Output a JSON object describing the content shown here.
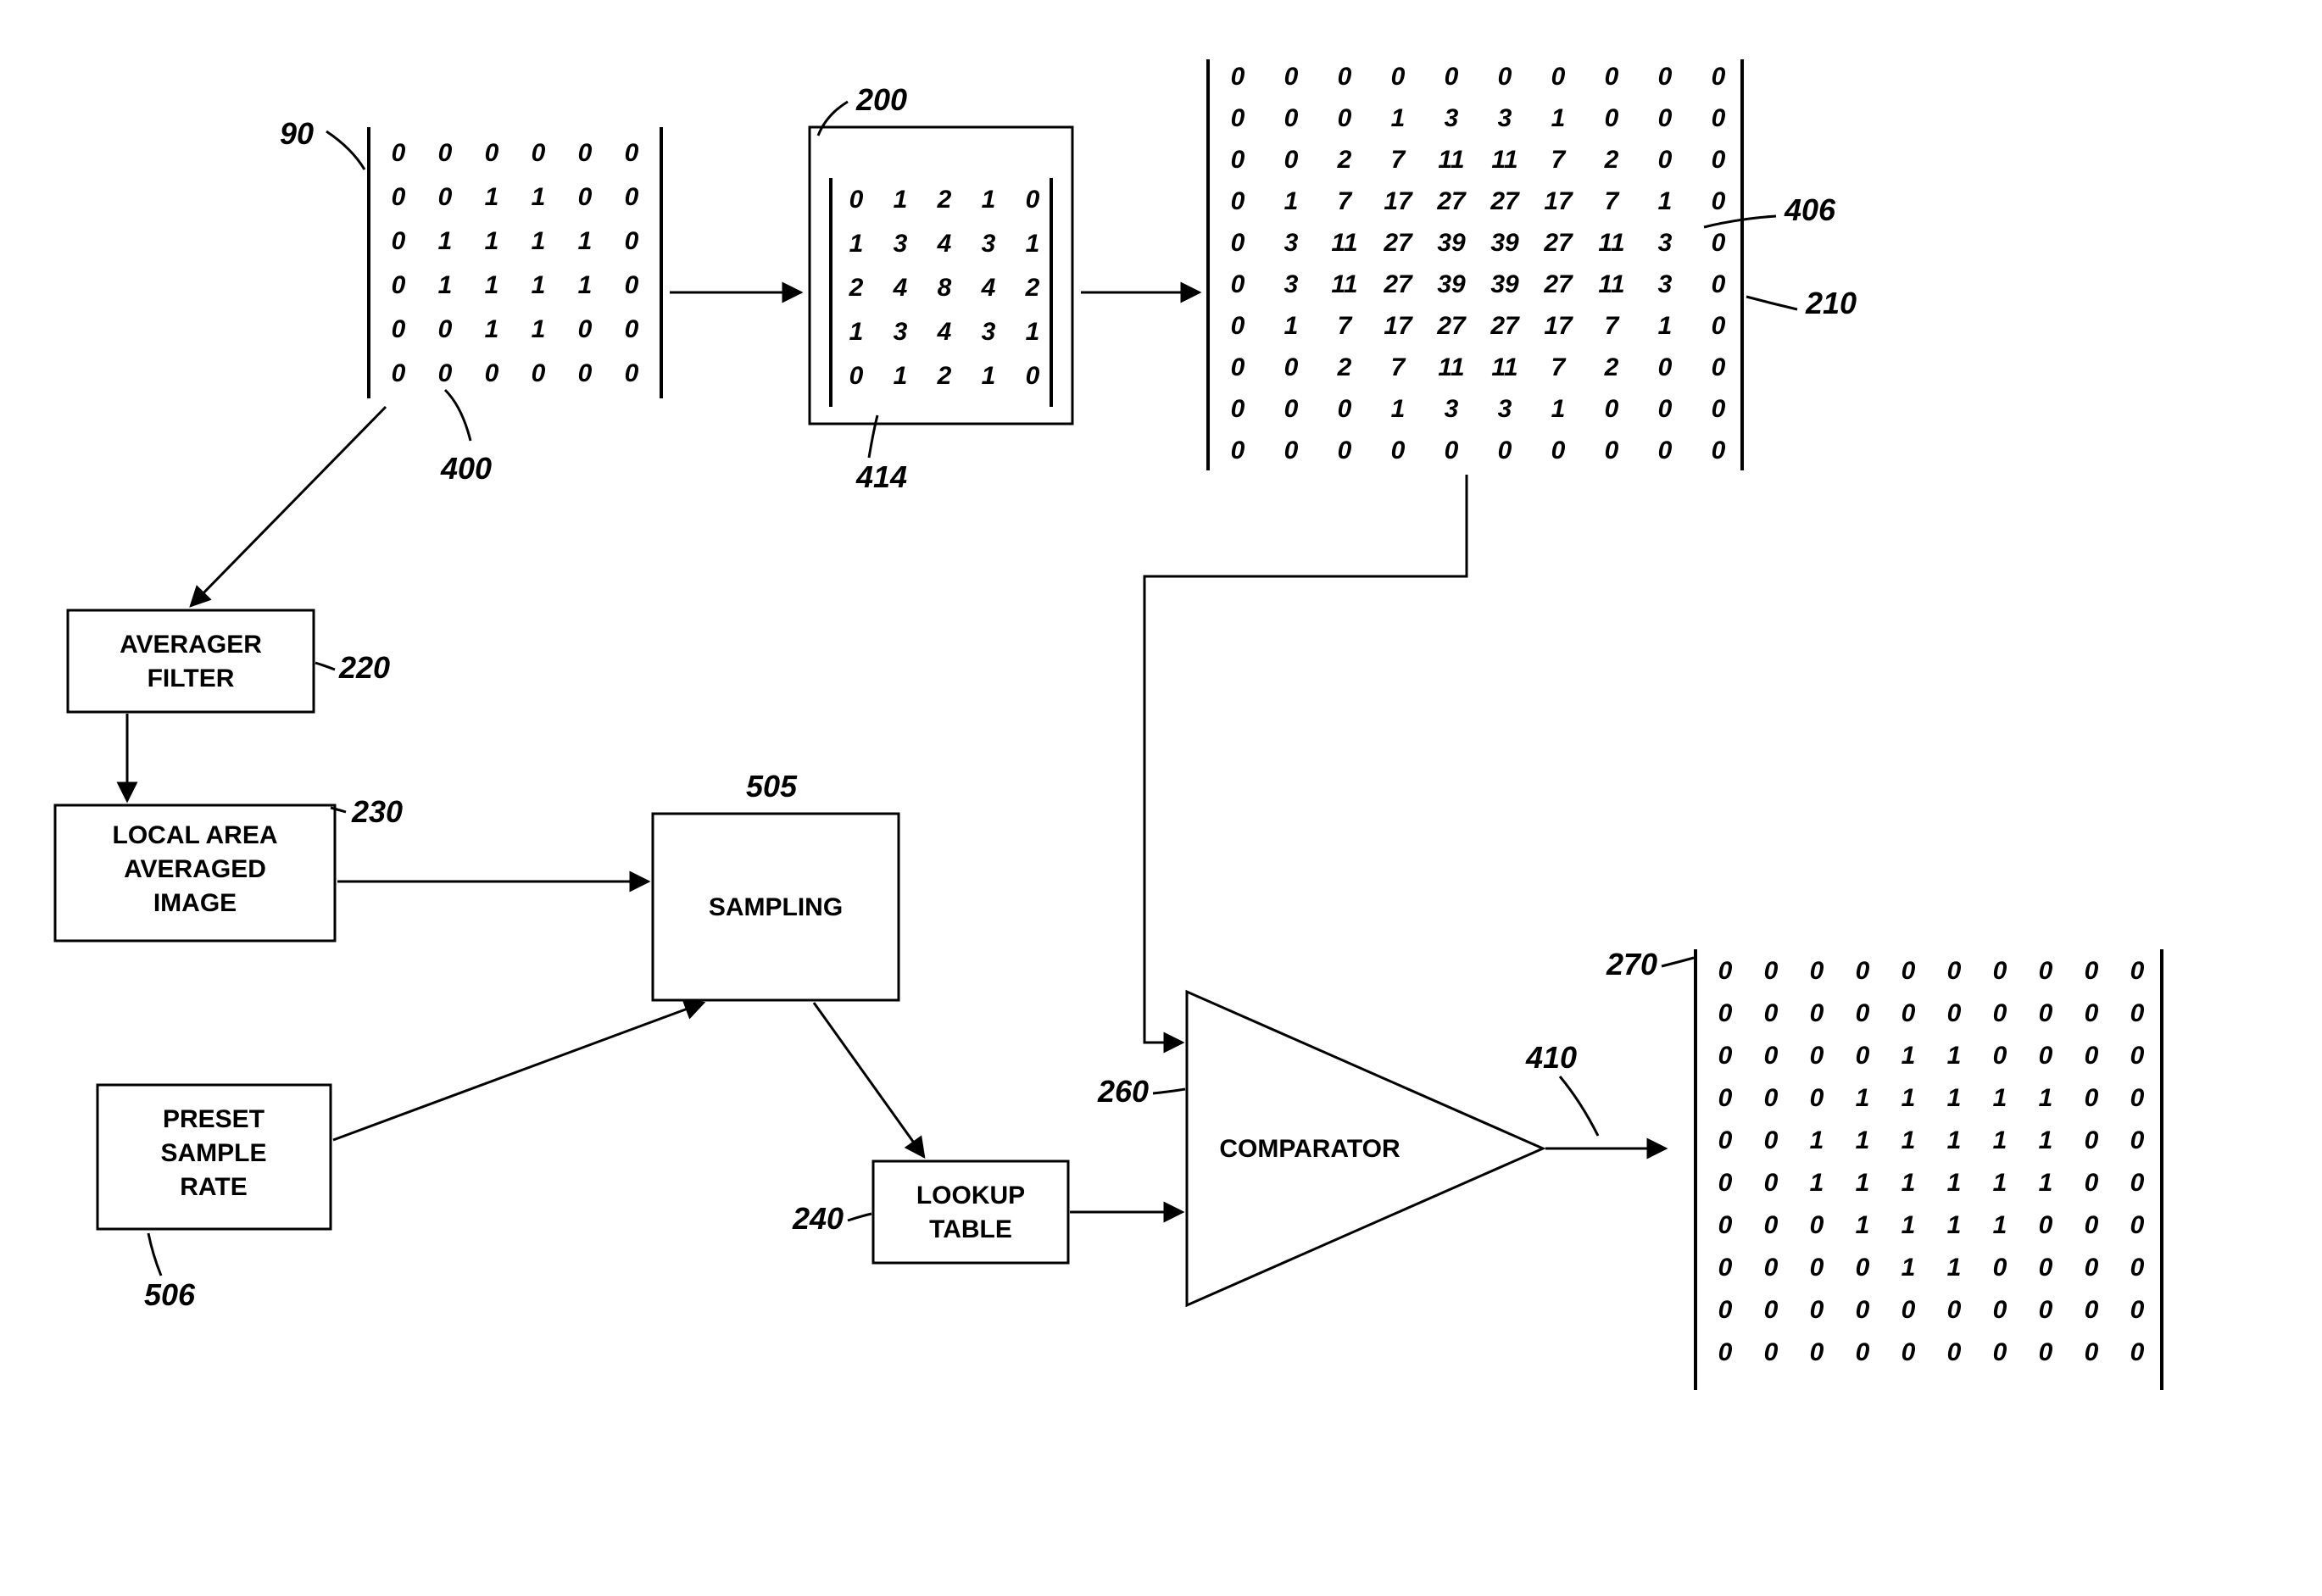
{
  "labels": {
    "l90": "90",
    "l200": "200",
    "l210": "210",
    "l400": "400",
    "l406": "406",
    "l414": "414",
    "l220": "220",
    "l230": "230",
    "l505": "505",
    "l506": "506",
    "l240": "240",
    "l260": "260",
    "l270": "270",
    "l410": "410"
  },
  "blocks": {
    "averager_l1": "AVERAGER",
    "averager_l2": "FILTER",
    "laa_l1": "LOCAL AREA",
    "laa_l2": "AVERAGED",
    "laa_l3": "IMAGE",
    "sampling": "SAMPLING",
    "preset_l1": "PRESET",
    "preset_l2": "SAMPLE",
    "preset_l3": "RATE",
    "lookup_l1": "LOOKUP",
    "lookup_l2": "TABLE",
    "comparator": "COMPARATOR"
  },
  "matrices": {
    "m90": [
      [
        "0",
        "0",
        "0",
        "0",
        "0",
        "0"
      ],
      [
        "0",
        "0",
        "1",
        "1",
        "0",
        "0"
      ],
      [
        "0",
        "1",
        "1",
        "1",
        "1",
        "0"
      ],
      [
        "0",
        "1",
        "1",
        "1",
        "1",
        "0"
      ],
      [
        "0",
        "0",
        "1",
        "1",
        "0",
        "0"
      ],
      [
        "0",
        "0",
        "0",
        "0",
        "0",
        "0"
      ]
    ],
    "m200": [
      [
        "0",
        "1",
        "2",
        "1",
        "0"
      ],
      [
        "1",
        "3",
        "4",
        "3",
        "1"
      ],
      [
        "2",
        "4",
        "8",
        "4",
        "2"
      ],
      [
        "1",
        "3",
        "4",
        "3",
        "1"
      ],
      [
        "0",
        "1",
        "2",
        "1",
        "0"
      ]
    ],
    "m210": [
      [
        "0",
        "0",
        "0",
        "0",
        "0",
        "0",
        "0",
        "0",
        "0",
        "0"
      ],
      [
        "0",
        "0",
        "0",
        "1",
        "3",
        "3",
        "1",
        "0",
        "0",
        "0"
      ],
      [
        "0",
        "0",
        "2",
        "7",
        "11",
        "11",
        "7",
        "2",
        "0",
        "0"
      ],
      [
        "0",
        "1",
        "7",
        "17",
        "27",
        "27",
        "17",
        "7",
        "1",
        "0"
      ],
      [
        "0",
        "3",
        "11",
        "27",
        "39",
        "39",
        "27",
        "11",
        "3",
        "0"
      ],
      [
        "0",
        "3",
        "11",
        "27",
        "39",
        "39",
        "27",
        "11",
        "3",
        "0"
      ],
      [
        "0",
        "1",
        "7",
        "17",
        "27",
        "27",
        "17",
        "7",
        "1",
        "0"
      ],
      [
        "0",
        "0",
        "2",
        "7",
        "11",
        "11",
        "7",
        "2",
        "0",
        "0"
      ],
      [
        "0",
        "0",
        "0",
        "1",
        "3",
        "3",
        "1",
        "0",
        "0",
        "0"
      ],
      [
        "0",
        "0",
        "0",
        "0",
        "0",
        "0",
        "0",
        "0",
        "0",
        "0"
      ]
    ],
    "m270": [
      [
        "0",
        "0",
        "0",
        "0",
        "0",
        "0",
        "0",
        "0",
        "0",
        "0"
      ],
      [
        "0",
        "0",
        "0",
        "0",
        "0",
        "0",
        "0",
        "0",
        "0",
        "0"
      ],
      [
        "0",
        "0",
        "0",
        "0",
        "1",
        "1",
        "0",
        "0",
        "0",
        "0"
      ],
      [
        "0",
        "0",
        "0",
        "1",
        "1",
        "1",
        "1",
        "1",
        "0",
        "0"
      ],
      [
        "0",
        "0",
        "1",
        "1",
        "1",
        "1",
        "1",
        "1",
        "0",
        "0"
      ],
      [
        "0",
        "0",
        "1",
        "1",
        "1",
        "1",
        "1",
        "1",
        "0",
        "0"
      ],
      [
        "0",
        "0",
        "0",
        "1",
        "1",
        "1",
        "1",
        "0",
        "0",
        "0"
      ],
      [
        "0",
        "0",
        "0",
        "0",
        "1",
        "1",
        "0",
        "0",
        "0",
        "0"
      ],
      [
        "0",
        "0",
        "0",
        "0",
        "0",
        "0",
        "0",
        "0",
        "0",
        "0"
      ],
      [
        "0",
        "0",
        "0",
        "0",
        "0",
        "0",
        "0",
        "0",
        "0",
        "0"
      ]
    ]
  }
}
